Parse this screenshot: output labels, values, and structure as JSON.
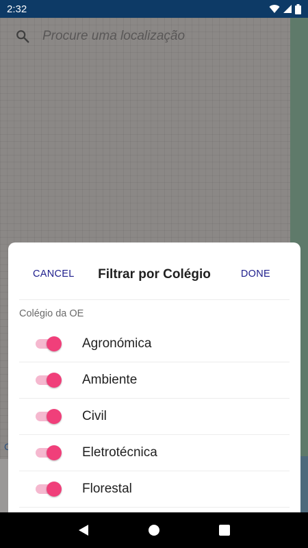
{
  "status_bar": {
    "time": "2:32",
    "icons": [
      "wifi-icon",
      "cell-signal-icon",
      "battery-icon"
    ]
  },
  "search": {
    "placeholder": "Procure uma localização",
    "icon": "search-icon"
  },
  "map": {
    "edge_letter": "C"
  },
  "dialog": {
    "cancel_label": "CANCEL",
    "title": "Filtrar por Colégio",
    "done_label": "DONE",
    "section_label": "Colégio da OE",
    "options": [
      {
        "label": "Agronómica",
        "enabled": true
      },
      {
        "label": "Ambiente",
        "enabled": true
      },
      {
        "label": "Civil",
        "enabled": true
      },
      {
        "label": "Eletrotécnica",
        "enabled": true
      },
      {
        "label": "Florestal",
        "enabled": true
      }
    ]
  },
  "nav_bar": {
    "buttons": [
      "back-icon",
      "home-icon",
      "recents-icon"
    ]
  },
  "colors": {
    "accent": "#f03f7a",
    "accent_track": "#f5b8cf",
    "action_text": "#1d1d8c",
    "status_bar": "#0d3a66"
  }
}
